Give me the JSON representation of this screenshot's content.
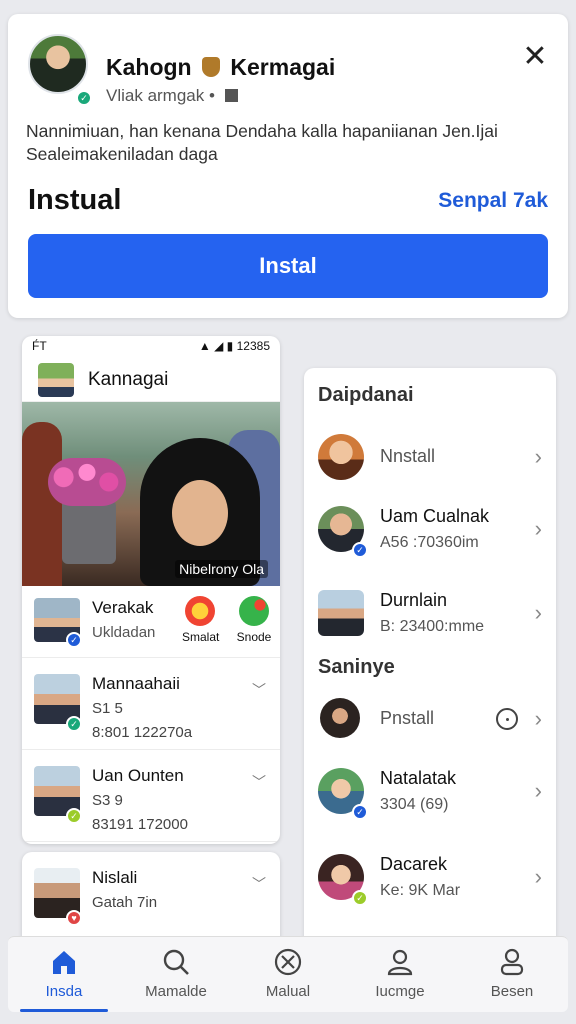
{
  "top_card": {
    "title": "Kahogn",
    "title_suffix": "Kermagai",
    "subtitle": "Vliak armgak •",
    "description": "Nannimiuan, han kenana Dendaha kalla hapaniianan Jen.Ijai Sealeimakeniladan daga",
    "label": "Instual",
    "link": "Senpal 7ak",
    "install_button": "Instal"
  },
  "phone": {
    "status_left": "F́T",
    "status_right": "12385",
    "app_name": "Kannagai",
    "photo_caption": "Nibelrony Ola",
    "profile": {
      "name": "Verakak",
      "sub": "Ukldadan"
    },
    "actions": [
      {
        "label": "Smalat",
        "color": "#f04432"
      },
      {
        "label": "Snode",
        "color": "#36b34a"
      }
    ],
    "feed": [
      {
        "name": "Mannaahaii",
        "line1": "S1 5",
        "line2": "8:801 122270a"
      },
      {
        "name": "Uan Ounten",
        "line1": "S3 9",
        "line2": "83191 172000"
      }
    ],
    "bottom_item": {
      "name": "Nislali",
      "sub": "Gatah 7in"
    }
  },
  "right_panel": {
    "section1_title": "Daipdanai",
    "section1": [
      {
        "single": "Nnstall"
      },
      {
        "title": "Uam Cualnak",
        "sub": "A56 :70360im"
      },
      {
        "title": "Durnlain",
        "sub": "B: 23400:mme"
      }
    ],
    "section2_title": "Saninye",
    "section2": [
      {
        "single": "Pnstall"
      },
      {
        "title": "Natalatak",
        "sub": "3304 (69)"
      },
      {
        "title": "Dacarek",
        "sub": "Ke: 9K Mar"
      }
    ]
  },
  "nav": [
    {
      "label": "Insda",
      "icon": "home-icon"
    },
    {
      "label": "Mamalde",
      "icon": "search-icon"
    },
    {
      "label": "Malual",
      "icon": "cancel-circle-icon"
    },
    {
      "label": "Iucmge",
      "icon": "person-icon"
    },
    {
      "label": "Besen",
      "icon": "profile-icon"
    }
  ],
  "colors": {
    "accent": "#2563f0",
    "link": "#1f5bd8"
  }
}
